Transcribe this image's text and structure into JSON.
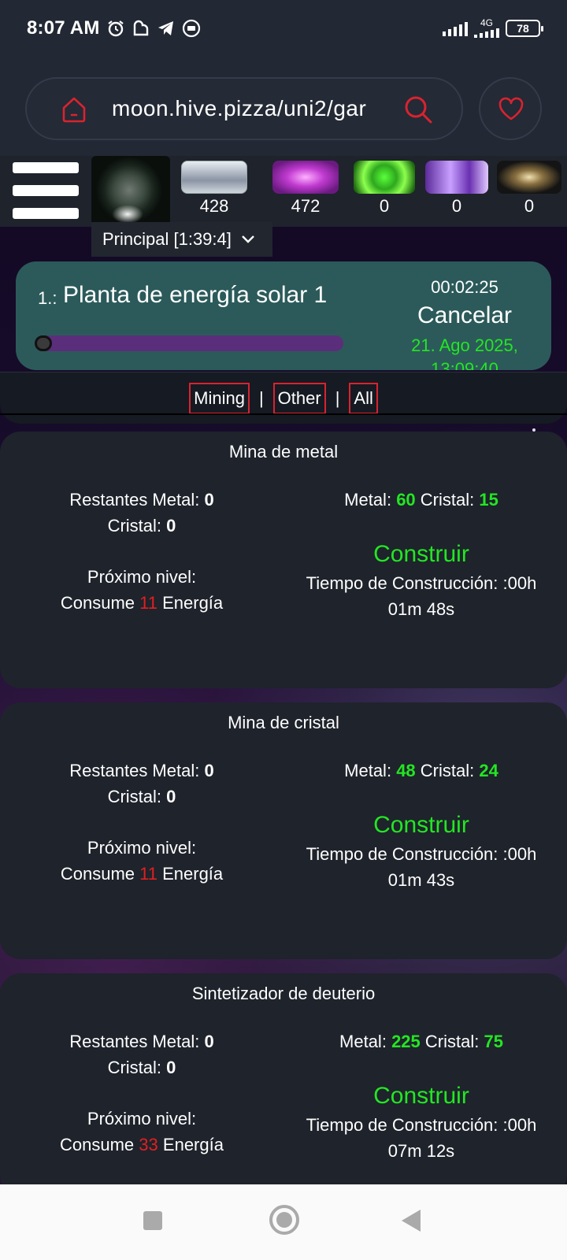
{
  "status_bar": {
    "time": "8:07 AM",
    "network": "4G",
    "battery": "78",
    "icons": [
      "alarm-icon",
      "app-icon",
      "telegram-icon",
      "video-icon",
      "signal-icon",
      "battery-icon"
    ]
  },
  "browser": {
    "url": "moon.hive.pizza/uni2/gar",
    "accent": "#d8232f"
  },
  "resources": [
    {
      "name": "metal",
      "value": "428"
    },
    {
      "name": "crystal",
      "value": "472"
    },
    {
      "name": "deuterium",
      "value": "0"
    },
    {
      "name": "energy",
      "value": "0"
    },
    {
      "name": "dark-matter",
      "value": "0"
    }
  ],
  "planet": {
    "selected": "Principal [1:39:4]"
  },
  "queue": {
    "number": "1.:",
    "name": "Planta de energía solar 1",
    "timer": "00:02:25",
    "cancel_label": "Cancelar",
    "date": "21. Ago 2025, 13:09:40",
    "progress": 0.03
  },
  "filters": {
    "mining": "Mining",
    "sep1": "|",
    "other": "Other",
    "sep2": "|",
    "all": "All"
  },
  "buildings": [
    {
      "name": "Mina de metal",
      "remaining_label": "Restantes Metal:",
      "remaining_metal": "0",
      "remaining_crystal_label": "Cristal:",
      "remaining_crystal": "0",
      "next_level": "Próximo nivel:",
      "consume_label": "Consume",
      "energy": "11",
      "energy_label": "Energía",
      "cost_metal_label": "Metal:",
      "cost_metal": "60",
      "cost_crystal_label": "Cristal:",
      "cost_crystal": "15",
      "build_label": "Construir",
      "time_label": "Tiempo de Construcción: :00h",
      "time_value": "01m 48s"
    },
    {
      "name": "Mina de cristal",
      "remaining_label": "Restantes Metal:",
      "remaining_metal": "0",
      "remaining_crystal_label": "Cristal:",
      "remaining_crystal": "0",
      "next_level": "Próximo nivel:",
      "consume_label": "Consume",
      "energy": "11",
      "energy_label": "Energía",
      "cost_metal_label": "Metal:",
      "cost_metal": "48",
      "cost_crystal_label": "Cristal:",
      "cost_crystal": "24",
      "build_label": "Construir",
      "time_label": "Tiempo de Construcción: :00h",
      "time_value": "01m 43s"
    },
    {
      "name": "Sintetizador de deuterio",
      "remaining_label": "Restantes Metal:",
      "remaining_metal": "0",
      "remaining_crystal_label": "Cristal:",
      "remaining_crystal": "0",
      "next_level": "Próximo nivel:",
      "consume_label": "Consume",
      "energy": "33",
      "energy_label": "Energía",
      "cost_metal_label": "Metal:",
      "cost_metal": "225",
      "cost_crystal_label": "Cristal:",
      "cost_crystal": "75",
      "build_label": "Construir",
      "time_label": "Tiempo de Construcción: :00h",
      "time_value": "07m 12s"
    }
  ]
}
